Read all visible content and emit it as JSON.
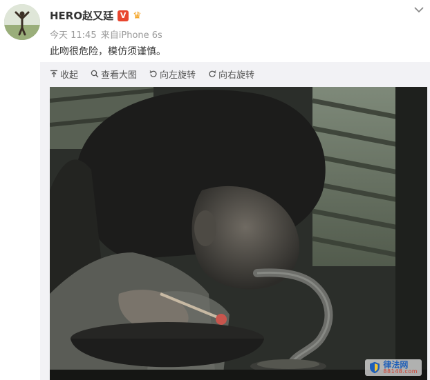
{
  "post": {
    "author": "HERO赵又廷",
    "verified_badge": "V",
    "member_icon": "crown-icon",
    "meta": {
      "time": "今天 11:45",
      "source": "来自iPhone 6s"
    },
    "text": "此吻很危险，模仿须谨慎。"
  },
  "toolbar": {
    "collapse": "收起",
    "view_large": "查看大图",
    "rotate_left": "向左旋转",
    "rotate_right": "向右旋转"
  },
  "photo": {
    "watermark_main": "律法网",
    "watermark_sub": "88148.com"
  },
  "colors": {
    "verified": "#e8462f",
    "member": "#f4a11d",
    "text": "#333333",
    "meta": "#999999"
  }
}
